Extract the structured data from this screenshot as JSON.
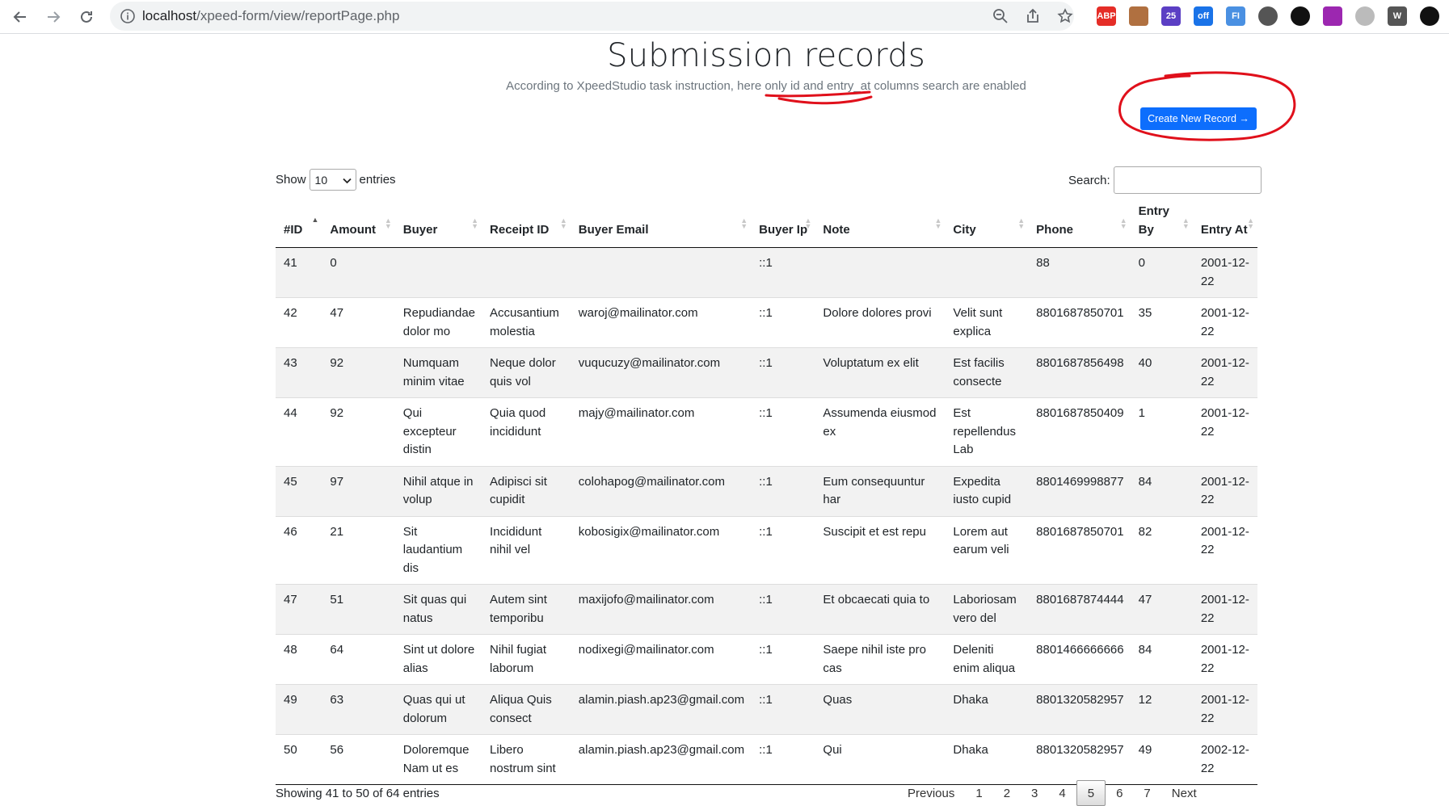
{
  "browser": {
    "url_host": "localhost",
    "url_path": "/xpeed-form/view/reportPage.php",
    "extensions": [
      {
        "icon": "abp-icon",
        "label": "ABP",
        "color": "#e52d27"
      },
      {
        "icon": "face-extension-icon",
        "label": "",
        "color": "#b07040"
      },
      {
        "icon": "graduation-cap-icon",
        "label": "25",
        "color": "#5b3fc4"
      },
      {
        "icon": "wifi-off-icon",
        "label": "off",
        "color": "#1a73e8"
      },
      {
        "icon": "fi-icon",
        "label": "FI",
        "color": "#4a90e2"
      },
      {
        "icon": "v-icon",
        "label": "",
        "color": "#555555"
      },
      {
        "icon": "stripe-icon",
        "label": "",
        "color": "#111111"
      },
      {
        "icon": "pen-icon",
        "label": "",
        "color": "#9c27b0"
      },
      {
        "icon": "circle-icon",
        "label": "",
        "color": "#bbbbbb"
      },
      {
        "icon": "w-icon",
        "label": "W",
        "color": "#555555"
      },
      {
        "icon": "puzzle-icon",
        "label": "",
        "color": "#111111"
      }
    ]
  },
  "page": {
    "title": "Submission records",
    "subtitle": "According to XpeedStudio task instruction, here only id and entry_at columns search are enabled",
    "create_button": "Create New Record →",
    "show_label": "Show",
    "entries_label": "entries",
    "page_length": "10",
    "search_label": "Search:",
    "search_value": ""
  },
  "table": {
    "columns": [
      "#ID",
      "Amount",
      "Buyer",
      "Receipt ID",
      "Buyer Email",
      "Buyer Ip",
      "Note",
      "City",
      "Phone",
      "Entry By",
      "Entry At"
    ],
    "rows": [
      [
        "41",
        "0",
        "",
        "",
        "",
        "::1",
        "",
        "",
        "88",
        "0",
        "2001-12-22"
      ],
      [
        "42",
        "47",
        "Repudiandae dolor mo",
        "Accusantium molestia",
        "waroj@mailinator.com",
        "::1",
        "Dolore dolores provi",
        "Velit sunt explica",
        "8801687850701",
        "35",
        "2001-12-22"
      ],
      [
        "43",
        "92",
        "Numquam minim vitae",
        "Neque dolor quis vol",
        "vuqucuzy@mailinator.com",
        "::1",
        "Voluptatum ex elit",
        "Est facilis consecte",
        "8801687856498",
        "40",
        "2001-12-22"
      ],
      [
        "44",
        "92",
        "Qui excepteur distin",
        "Quia quod incididunt",
        "majy@mailinator.com",
        "::1",
        "Assumenda eiusmod ex",
        "Est repellendus Lab",
        "8801687850409",
        "1",
        "2001-12-22"
      ],
      [
        "45",
        "97",
        "Nihil atque in volup",
        "Adipisci sit cupidit",
        "colohapog@mailinator.com",
        "::1",
        "Eum consequuntur har",
        "Expedita iusto cupid",
        "8801469998877",
        "84",
        "2001-12-22"
      ],
      [
        "46",
        "21",
        "Sit laudantium dis",
        "Incididunt nihil vel",
        "kobosigix@mailinator.com",
        "::1",
        "Suscipit et est repu",
        "Lorem aut earum veli",
        "8801687850701",
        "82",
        "2001-12-22"
      ],
      [
        "47",
        "51",
        "Sit quas qui natus",
        "Autem sint temporibu",
        "maxijofo@mailinator.com",
        "::1",
        "Et obcaecati quia to",
        "Laboriosam vero del",
        "8801687874444",
        "47",
        "2001-12-22"
      ],
      [
        "48",
        "64",
        "Sint ut dolore alias",
        "Nihil fugiat laborum",
        "nodixegi@mailinator.com",
        "::1",
        "Saepe nihil iste pro cas",
        "Deleniti enim aliqua",
        "8801466666666",
        "84",
        "2001-12-22"
      ],
      [
        "49",
        "63",
        "Quas qui ut dolorum",
        "Aliqua Quis consect",
        "alamin.piash.ap23@gmail.com",
        "::1",
        "Quas",
        "Dhaka",
        "8801320582957",
        "12",
        "2001-12-22"
      ],
      [
        "50",
        "56",
        "Doloremque Nam ut es",
        "Libero nostrum sint",
        "alamin.piash.ap23@gmail.com",
        "::1",
        "Qui",
        "Dhaka",
        "8801320582957",
        "49",
        "2002-12-22"
      ]
    ]
  },
  "footer": {
    "info": "Showing 41 to 50 of 64 entries",
    "previous": "Previous",
    "next": "Next",
    "pages": [
      "1",
      "2",
      "3",
      "4",
      "5",
      "6",
      "7"
    ],
    "current_page": "5"
  },
  "colors": {
    "primary": "#0d6efd",
    "annotation_red": "#e0101b",
    "stripe": "#f2f2f2"
  }
}
